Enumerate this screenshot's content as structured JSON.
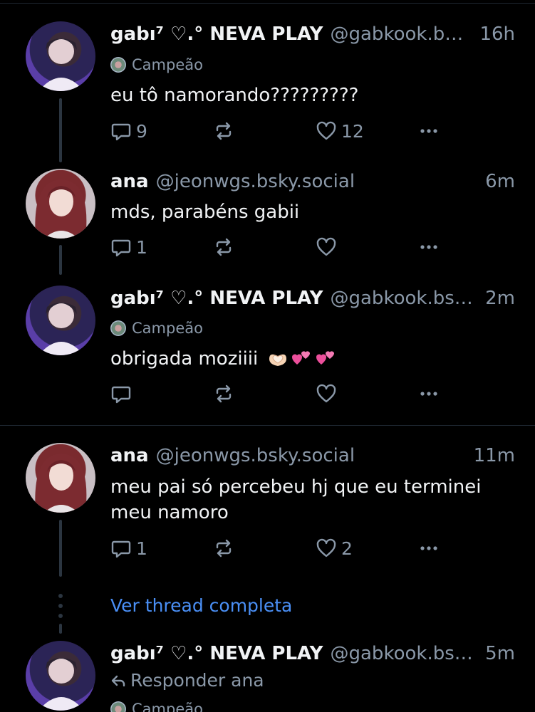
{
  "posts": [
    {
      "display_name": "gabı⁷ ♡.° NEVA PLAY",
      "handle": "@gabkook.bsky...",
      "time": "16h",
      "badge": "Campeão",
      "text": "eu tô namorando?????????",
      "reply_count": "9",
      "like_count": "12"
    },
    {
      "display_name": "ana",
      "handle": "@jeonwgs.bsky.social",
      "time": "6m",
      "text": "mds, parabéns gabii",
      "reply_count": "1",
      "like_count": ""
    },
    {
      "display_name": "gabı⁷ ♡.° NEVA PLAY",
      "handle": "@gabkook.bsky....",
      "time": "2m",
      "badge": "Campeão",
      "text": "obrigada moziiii",
      "emoji": [
        "heart-hands-emoji",
        "two-hearts-emoji",
        "two-hearts-emoji"
      ],
      "reply_count": "",
      "like_count": ""
    },
    {
      "display_name": "ana",
      "handle": "@jeonwgs.bsky.social",
      "time": "11m",
      "text_line1": "meu pai só percebeu hj que eu terminei",
      "text_line2": "meu namoro",
      "reply_count": "1",
      "like_count": "2"
    },
    {
      "display_name": "gabı⁷ ♡.° NEVA PLAY",
      "handle": "@gabkook.bsky...",
      "time": "5m",
      "reply_to": "Responder ana",
      "badge": "Campeão"
    }
  ],
  "thread_link": "Ver thread completa",
  "colors": {
    "background": "#000000",
    "text": "#f1f3f5",
    "muted": "#8a98a8",
    "link": "#4a8ff5",
    "divider": "#1e2732"
  }
}
